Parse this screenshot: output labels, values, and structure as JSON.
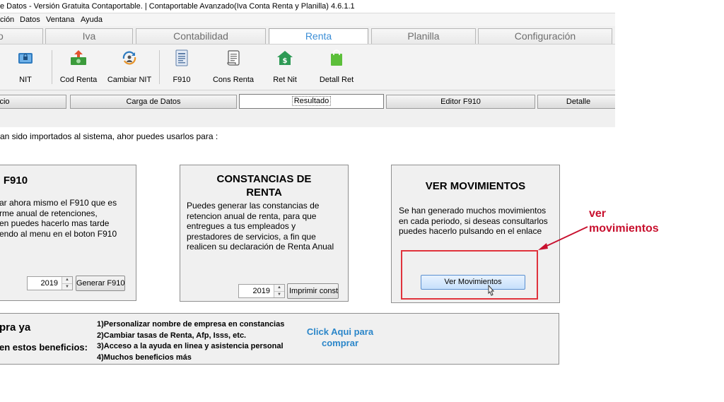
{
  "window": {
    "title": "e Datos - Versión Gratuita Contaportable. | Contaportable Avanzado(Iva Conta Renta y Planilla) 4.6.1.1"
  },
  "menu": {
    "items": [
      "ción",
      "Datos",
      "Ventana",
      "Ayuda"
    ]
  },
  "main_tabs": {
    "items": [
      "o",
      "Iva",
      "Contabilidad",
      "Renta",
      "Planilla",
      "Configuración"
    ],
    "active": "Renta"
  },
  "toolbar": {
    "buttons": [
      {
        "label": "NIT",
        "icon": "lock-card-icon"
      },
      {
        "label": "Cod Renta",
        "icon": "money-upload-icon"
      },
      {
        "label": "Cambiar NIT",
        "icon": "refresh-user-icon"
      },
      {
        "label": "F910",
        "icon": "form-document-icon"
      },
      {
        "label": "Cons Renta",
        "icon": "scroll-document-icon"
      },
      {
        "label": "Ret Nit",
        "icon": "house-dollar-icon"
      },
      {
        "label": "Detall Ret",
        "icon": "shopping-bag-icon"
      }
    ]
  },
  "sub_tabs": {
    "items": [
      "icio",
      "Carga de Datos",
      "Resultado",
      "Editor F910",
      "Detalle"
    ],
    "active": "Resultado"
  },
  "intro_text": "an sido importados al sistema, ahor puedes usarlos para :",
  "cards": {
    "f910": {
      "title": "F910",
      "lines": [
        "ar ahora mismo el F910 que es",
        "rme anual de retenciones,",
        "en puedes hacerlo mas tarde",
        "endo al menu en el boton F910"
      ],
      "year": "2019",
      "button": "Generar F910"
    },
    "constancias": {
      "title_line1": "CONSTANCIAS DE",
      "title_line2": "RENTA",
      "lines": [
        "Puedes generar las constancias de",
        "retencion anual de renta, para que",
        "entregues a tus empleados y",
        "prestadores de servicios, a fin que",
        "realicen su declaración de  Renta Anual"
      ],
      "year": "2019",
      "button": "Imprimir const"
    },
    "movimientos": {
      "title": "VER MOVIMIENTOS",
      "lines": [
        "Se han generado muchos movimientos",
        "en cada periodo, si deseas consultarlos",
        "puedes hacerlo pulsando en el enlace"
      ],
      "button": "Ver Movimientos"
    }
  },
  "annotation": {
    "line1": "ver",
    "line2": "movimientos",
    "color": "#c8102e"
  },
  "promo": {
    "heading": "pra ya",
    "subheading": "en estos beneficios:",
    "benefits": [
      "1)Personalizar nombre de empresa en constancias",
      "2)Cambiar tasas de Renta, Afp, Isss, etc.",
      "3)Acceso a la ayuda en linea y asistencia personal",
      "4)Muchos beneficios más"
    ],
    "link_line1": "Click Aqui para",
    "link_line2": "comprar",
    "link_color": "#2b86c9"
  }
}
